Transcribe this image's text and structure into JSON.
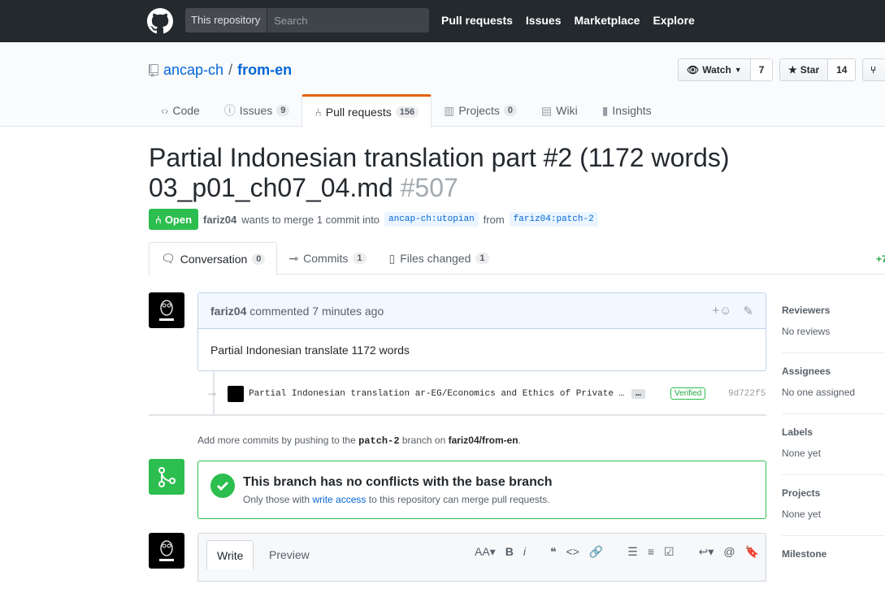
{
  "header": {
    "search_scope": "This repository",
    "search_placeholder": "Search",
    "nav": [
      "Pull requests",
      "Issues",
      "Marketplace",
      "Explore"
    ]
  },
  "repo": {
    "owner": "ancap-ch",
    "separator": "/",
    "name": "from-en",
    "watch_label": "Watch",
    "watch_count": "7",
    "star_label": "Star",
    "star_count": "14",
    "tabs": [
      {
        "label": "Code",
        "icon": "code-icon"
      },
      {
        "label": "Issues",
        "count": "9",
        "icon": "issue-icon"
      },
      {
        "label": "Pull requests",
        "count": "156",
        "icon": "pull-request-icon",
        "selected": true
      },
      {
        "label": "Projects",
        "count": "0",
        "icon": "project-icon"
      },
      {
        "label": "Wiki",
        "icon": "book-icon"
      },
      {
        "label": "Insights",
        "icon": "graph-icon"
      }
    ]
  },
  "pr": {
    "title": "Partial Indonesian translation part #2 (1172 words) 03_p01_ch07_04.md",
    "number": "#507",
    "state": "Open",
    "author": "fariz04",
    "meta_text": "wants to merge 1 commit into",
    "base_branch": "ancap-ch:utopian",
    "from_text": "from",
    "head_branch": "fariz04:patch-2",
    "tabs": [
      {
        "label": "Conversation",
        "count": "0"
      },
      {
        "label": "Commits",
        "count": "1"
      },
      {
        "label": "Files changed",
        "count": "1"
      }
    ],
    "diff_add": "+7"
  },
  "comment": {
    "author": "fariz04",
    "action": "commented 7 minutes ago",
    "body": "Partial Indonesian translate 1172 words"
  },
  "commit": {
    "message": "Partial Indonesian translation ar-EG/Economics and Ethics of Private …",
    "ellipsis": "…",
    "verified": "Verified",
    "sha": "9d722f5"
  },
  "hint": {
    "prefix": "Add more commits by pushing to the",
    "branch": "patch-2",
    "middle": "branch on",
    "repo": "fariz04/from-en",
    "suffix": "."
  },
  "merge": {
    "title": "This branch has no conflicts with the base branch",
    "desc_prefix": "Only those with",
    "desc_link": "write access",
    "desc_suffix": "to this repository can merge pull requests."
  },
  "editor": {
    "write_tab": "Write",
    "preview_tab": "Preview",
    "tools": [
      "AA▾",
      "B",
      "i",
      "❝",
      "<>",
      "🔗",
      "☰",
      "≡",
      "☑",
      "↩▾",
      "@",
      "🔖"
    ]
  },
  "sidebar": [
    {
      "heading": "Reviewers",
      "value": "No reviews"
    },
    {
      "heading": "Assignees",
      "value": "No one assigned"
    },
    {
      "heading": "Labels",
      "value": "None yet"
    },
    {
      "heading": "Projects",
      "value": "None yet"
    },
    {
      "heading": "Milestone",
      "value": ""
    }
  ],
  "colors": {
    "topbar": "#24292e",
    "open_green": "#2cbe4e",
    "link": "#0366d6",
    "tab_accent": "#e36209"
  }
}
